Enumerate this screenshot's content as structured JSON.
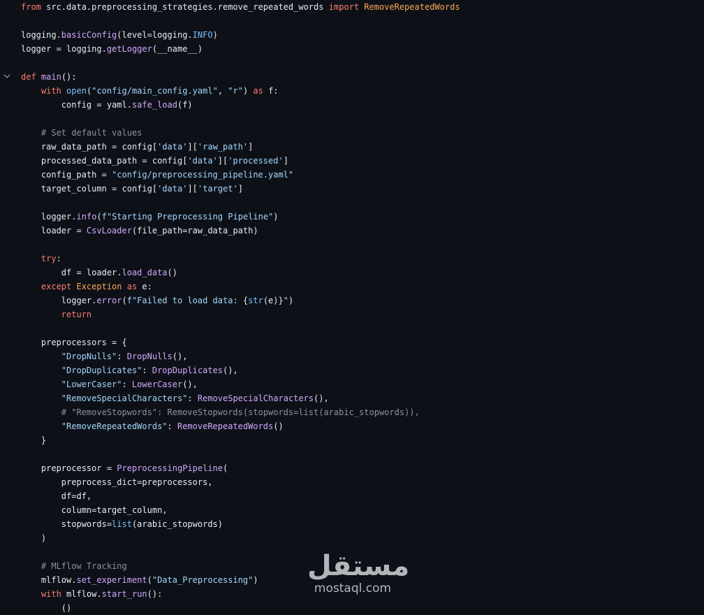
{
  "code_lines": [
    [
      {
        "t": "from ",
        "c": "kw"
      },
      {
        "t": "src.data.preprocessing_strategies.remove_repeated_words ",
        "c": "pl"
      },
      {
        "t": "import ",
        "c": "kw"
      },
      {
        "t": "RemoveRepeatedWords",
        "c": "cls"
      }
    ],
    [],
    [
      {
        "t": "logging.",
        "c": "pl"
      },
      {
        "t": "basicConfig",
        "c": "fn"
      },
      {
        "t": "(level=logging.",
        "c": "pl"
      },
      {
        "t": "INFO",
        "c": "cn"
      },
      {
        "t": ")",
        "c": "pl"
      }
    ],
    [
      {
        "t": "logger = logging.",
        "c": "pl"
      },
      {
        "t": "getLogger",
        "c": "fn"
      },
      {
        "t": "(__name__)",
        "c": "pl"
      }
    ],
    [],
    [
      {
        "t": "def ",
        "c": "kw"
      },
      {
        "t": "main",
        "c": "fn"
      },
      {
        "t": "():",
        "c": "pl"
      }
    ],
    [
      {
        "t": "    "
      },
      {
        "t": "with ",
        "c": "kw"
      },
      {
        "t": "open",
        "c": "cn"
      },
      {
        "t": "(",
        "c": "pl"
      },
      {
        "t": "\"config/main_config.yaml\"",
        "c": "st"
      },
      {
        "t": ", ",
        "c": "pl"
      },
      {
        "t": "\"r\"",
        "c": "st"
      },
      {
        "t": ") ",
        "c": "pl"
      },
      {
        "t": "as ",
        "c": "kw"
      },
      {
        "t": "f:",
        "c": "pl"
      }
    ],
    [
      {
        "t": "        config = yaml.",
        "c": "pl"
      },
      {
        "t": "safe_load",
        "c": "fn"
      },
      {
        "t": "(f)",
        "c": "pl"
      }
    ],
    [],
    [
      {
        "t": "    "
      },
      {
        "t": "# Set default values",
        "c": "cm"
      }
    ],
    [
      {
        "t": "    raw_data_path = config[",
        "c": "pl"
      },
      {
        "t": "'data'",
        "c": "st"
      },
      {
        "t": "][",
        "c": "pl"
      },
      {
        "t": "'raw_path'",
        "c": "st"
      },
      {
        "t": "]",
        "c": "pl"
      }
    ],
    [
      {
        "t": "    processed_data_path = config[",
        "c": "pl"
      },
      {
        "t": "'data'",
        "c": "st"
      },
      {
        "t": "][",
        "c": "pl"
      },
      {
        "t": "'processed'",
        "c": "st"
      },
      {
        "t": "]",
        "c": "pl"
      }
    ],
    [
      {
        "t": "    config_path = ",
        "c": "pl"
      },
      {
        "t": "\"config/preprocessing_pipeline.yaml\"",
        "c": "st"
      }
    ],
    [
      {
        "t": "    target_column = config[",
        "c": "pl"
      },
      {
        "t": "'data'",
        "c": "st"
      },
      {
        "t": "][",
        "c": "pl"
      },
      {
        "t": "'target'",
        "c": "st"
      },
      {
        "t": "]",
        "c": "pl"
      }
    ],
    [],
    [
      {
        "t": "    logger.",
        "c": "pl"
      },
      {
        "t": "info",
        "c": "fn"
      },
      {
        "t": "(",
        "c": "pl"
      },
      {
        "t": "f\"Starting Preprocessing Pipeline\"",
        "c": "st"
      },
      {
        "t": ")",
        "c": "pl"
      }
    ],
    [
      {
        "t": "    loader = ",
        "c": "pl"
      },
      {
        "t": "CsvLoader",
        "c": "fn"
      },
      {
        "t": "(file_path=raw_data_path)",
        "c": "pl"
      }
    ],
    [],
    [
      {
        "t": "    "
      },
      {
        "t": "try",
        "c": "kw"
      },
      {
        "t": ":",
        "c": "pl"
      }
    ],
    [
      {
        "t": "        df = loader.",
        "c": "pl"
      },
      {
        "t": "load_data",
        "c": "fn"
      },
      {
        "t": "()",
        "c": "pl"
      }
    ],
    [
      {
        "t": "    "
      },
      {
        "t": "except ",
        "c": "kw"
      },
      {
        "t": "Exception ",
        "c": "cls"
      },
      {
        "t": "as ",
        "c": "kw"
      },
      {
        "t": "e:",
        "c": "pl"
      }
    ],
    [
      {
        "t": "        logger.",
        "c": "pl"
      },
      {
        "t": "error",
        "c": "fn"
      },
      {
        "t": "(",
        "c": "pl"
      },
      {
        "t": "f\"Failed to load data: ",
        "c": "st"
      },
      {
        "t": "{",
        "c": "pl"
      },
      {
        "t": "str",
        "c": "cn"
      },
      {
        "t": "(e)}",
        "c": "pl"
      },
      {
        "t": "\"",
        "c": "st"
      },
      {
        "t": ")",
        "c": "pl"
      }
    ],
    [
      {
        "t": "        "
      },
      {
        "t": "return",
        "c": "kw"
      }
    ],
    [],
    [
      {
        "t": "    preprocessors = {",
        "c": "pl"
      }
    ],
    [
      {
        "t": "        "
      },
      {
        "t": "\"DropNulls\"",
        "c": "st"
      },
      {
        "t": ": ",
        "c": "pl"
      },
      {
        "t": "DropNulls",
        "c": "fn"
      },
      {
        "t": "(),",
        "c": "pl"
      }
    ],
    [
      {
        "t": "        "
      },
      {
        "t": "\"DropDuplicates\"",
        "c": "st"
      },
      {
        "t": ": ",
        "c": "pl"
      },
      {
        "t": "DropDuplicates",
        "c": "fn"
      },
      {
        "t": "(),",
        "c": "pl"
      }
    ],
    [
      {
        "t": "        "
      },
      {
        "t": "\"LowerCaser\"",
        "c": "st"
      },
      {
        "t": ": ",
        "c": "pl"
      },
      {
        "t": "LowerCaser",
        "c": "fn"
      },
      {
        "t": "(),",
        "c": "pl"
      }
    ],
    [
      {
        "t": "        "
      },
      {
        "t": "\"RemoveSpecialCharacters\"",
        "c": "st"
      },
      {
        "t": ": ",
        "c": "pl"
      },
      {
        "t": "RemoveSpecialCharacters",
        "c": "fn"
      },
      {
        "t": "(),",
        "c": "pl"
      }
    ],
    [
      {
        "t": "        "
      },
      {
        "t": "# \"RemoveStopwords\": RemoveStopwords(stopwords=list(arabic_stopwords)),",
        "c": "cm"
      }
    ],
    [
      {
        "t": "        "
      },
      {
        "t": "\"RemoveRepeatedWords\"",
        "c": "st"
      },
      {
        "t": ": ",
        "c": "pl"
      },
      {
        "t": "RemoveRepeatedWords",
        "c": "fn"
      },
      {
        "t": "()",
        "c": "pl"
      }
    ],
    [
      {
        "t": "    }",
        "c": "pl"
      }
    ],
    [],
    [
      {
        "t": "    preprocessor = ",
        "c": "pl"
      },
      {
        "t": "PreprocessingPipeline",
        "c": "fn"
      },
      {
        "t": "(",
        "c": "pl"
      }
    ],
    [
      {
        "t": "        preprocess_dict=preprocessors,",
        "c": "pl"
      }
    ],
    [
      {
        "t": "        df=df,",
        "c": "pl"
      }
    ],
    [
      {
        "t": "        column=target_column,",
        "c": "pl"
      }
    ],
    [
      {
        "t": "        stopwords=",
        "c": "pl"
      },
      {
        "t": "list",
        "c": "cn"
      },
      {
        "t": "(arabic_stopwords)",
        "c": "pl"
      }
    ],
    [
      {
        "t": "    )",
        "c": "pl"
      }
    ],
    [],
    [
      {
        "t": "    "
      },
      {
        "t": "# MLflow Tracking",
        "c": "cm"
      }
    ],
    [
      {
        "t": "    mlflow.",
        "c": "pl"
      },
      {
        "t": "set_experiment",
        "c": "fn"
      },
      {
        "t": "(",
        "c": "pl"
      },
      {
        "t": "\"Data_Preprocessing\"",
        "c": "st"
      },
      {
        "t": ")",
        "c": "pl"
      }
    ],
    [
      {
        "t": "    "
      },
      {
        "t": "with ",
        "c": "kw"
      },
      {
        "t": "mlflow.",
        "c": "pl"
      },
      {
        "t": "start_run",
        "c": "fn"
      },
      {
        "t": "():",
        "c": "pl"
      }
    ],
    [
      {
        "t": "        "
      },
      {
        "t": "()",
        "c": "pl"
      }
    ]
  ],
  "watermark": {
    "arabic": "مستقل",
    "latin": "mostaql.com"
  },
  "colors": {
    "background": "#0d1117",
    "keyword": "#ff7b72",
    "function": "#d2a8ff",
    "string": "#a5d6ff",
    "comment": "#8b949e",
    "constant": "#79c0ff",
    "class": "#ffa657"
  },
  "icons": {
    "fold": "chevron-down-icon"
  }
}
